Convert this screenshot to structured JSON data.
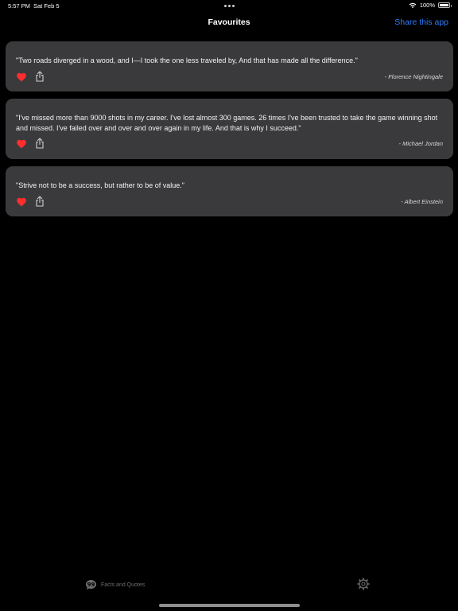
{
  "status_bar": {
    "time": "5:57 PM",
    "date": "Sat Feb 5",
    "battery": "100%",
    "wifi_icon": "wifi-icon"
  },
  "nav": {
    "title": "Favourites",
    "share_app_label": "Share this app"
  },
  "favourites": [
    {
      "quote": "\"Two roads diverged in a wood, and I—I took the one less traveled by, And that has made all the difference.\"",
      "author": "- Florence Nightingale"
    },
    {
      "quote": "\"I've missed more than 9000 shots in my career. I've lost almost 300 games. 26 times I've been trusted to take the game winning shot and missed. I've failed over and over and over again in my life. And that is why I succeed.\"",
      "author": "- Michael Jordan"
    },
    {
      "quote": "\"Strive not to be a success, but rather to be of value.\"",
      "author": "- Albert Einstein"
    }
  ],
  "tab_bar": {
    "facts_label": "Facts and Quotes"
  },
  "colors": {
    "accent": "#2f7cf6",
    "heart": "#ff2d2d",
    "card_bg": "#3a3a3c",
    "background": "#000000"
  }
}
